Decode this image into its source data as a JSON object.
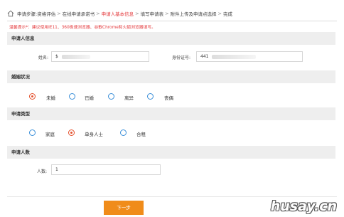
{
  "breadcrumb": {
    "home_icon": "home-icon",
    "step_label": "申请步骤:",
    "steps": [
      "资格评估",
      "在线申请承诺书",
      "申请人基本信息",
      "填写申请表",
      "附件上传及申请点选择",
      "完成"
    ],
    "separator": ">",
    "active_color": "#e4393c"
  },
  "tip": "温馨提示*：建议使用IE11、360极速浏览器、谷歌Chrome和火狐浏览器填写。",
  "applicant_info": {
    "title": "申请人信息",
    "name_label": "姓名:",
    "name_value": "$",
    "id_label": "身份证号:",
    "id_value": "441"
  },
  "marital": {
    "title": "婚姻状况",
    "options": [
      "未婚",
      "已婚",
      "离异",
      "丧偶"
    ],
    "selected": "未婚"
  },
  "apply_type": {
    "title": "申请类型",
    "options": [
      "家庭",
      "单身人士",
      "合租"
    ],
    "selected": "单身人士"
  },
  "count": {
    "title": "申请人数",
    "label": "人数:",
    "value": "1"
  },
  "next_button": "下一步",
  "watermark": "husay.cn",
  "colors": {
    "accent": "#f08c1a",
    "radio": "#3a8fd9",
    "radio_selected": "#e4512d"
  }
}
